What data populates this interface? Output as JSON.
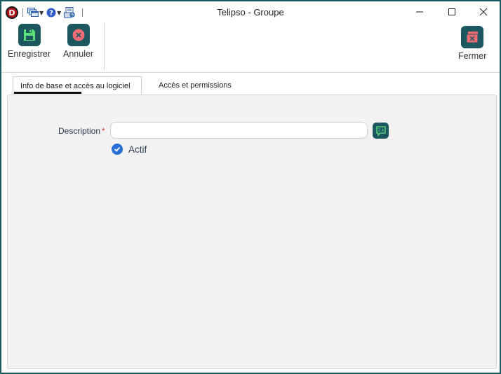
{
  "window": {
    "title": "Telipso - Groupe",
    "accent": "#1e5b63"
  },
  "quick_access": {
    "app_logo_letter": "D",
    "items": [
      "windows-icon",
      "help-icon",
      "print-preview-icon"
    ]
  },
  "ribbon": {
    "save_label": "Enregistrer",
    "cancel_label": "Annuler",
    "close_label": "Fermer"
  },
  "tabs": [
    {
      "label": "Info de base et accès au logiciel",
      "active": true
    },
    {
      "label": "Accès et permissions",
      "active": false
    }
  ],
  "form": {
    "description_label": "Description",
    "required_marker": "*",
    "description_value": "",
    "actif_label": "Actif",
    "actif_checked": true
  },
  "colors": {
    "button_bg": "#1c5760",
    "save_icon": "#5ee07a",
    "cancel_icon": "#f06b72",
    "close_icon": "#f06b72",
    "checkbox": "#2a6fd6",
    "required": "#c0392b"
  }
}
